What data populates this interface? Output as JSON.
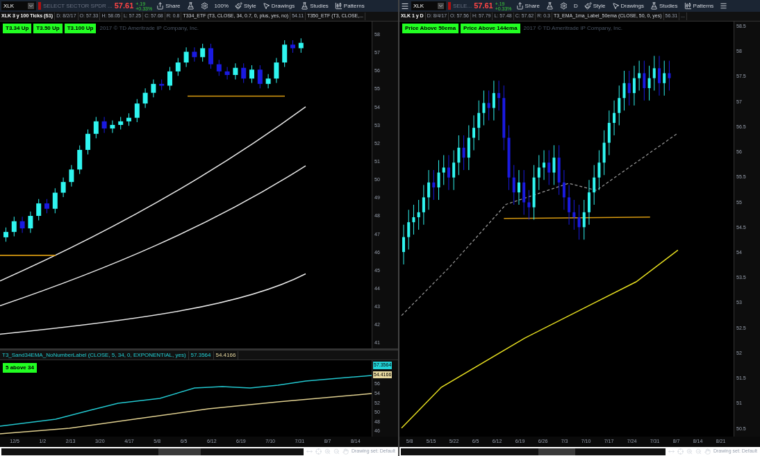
{
  "left": {
    "toolbar": {
      "symbol": "XLK",
      "description": "SELECT SECTOR SPDR ...",
      "last": "57.61",
      "change": "+.19",
      "change_pct": "+0.33%",
      "buttons": [
        {
          "kind": "share",
          "label": "Share"
        },
        {
          "kind": "flask"
        },
        {
          "kind": "gear"
        },
        {
          "kind": "text",
          "label": "100%"
        },
        {
          "kind": "style",
          "label": "Style"
        },
        {
          "kind": "pointer",
          "label": "Drawings"
        },
        {
          "kind": "flask",
          "label": "Studies"
        },
        {
          "kind": "patterns",
          "label": "Patterns"
        }
      ]
    },
    "header": [
      {
        "kind": "title",
        "text": "XLK 3 y 100 Ticks (S1)"
      },
      {
        "kind": "field",
        "text": "D: 8/2/17"
      },
      {
        "kind": "field",
        "text": "O: 57.33"
      },
      {
        "kind": "field",
        "text": "H: 58.05"
      },
      {
        "kind": "field",
        "text": "L: 57.25"
      },
      {
        "kind": "field",
        "text": "C: 57.68"
      },
      {
        "kind": "field",
        "text": "R: 0.8"
      },
      {
        "kind": "study",
        "text": "T334_ETF (T3, CLOSE, 34, 0.7, 0, plus, yes, no)"
      },
      {
        "kind": "field",
        "text": "54.11"
      },
      {
        "kind": "study",
        "text": "T350_ETF (T3, CLOSE,..."
      }
    ],
    "badges": [
      "T3.34 Up",
      "T3.50 Up",
      "T3.100 Up"
    ],
    "copyright": "2017 © TD Ameritrade IP Company, Inc.",
    "price_axis": [
      "58",
      "57",
      "56",
      "55",
      "54",
      "53",
      "52",
      "51",
      "50",
      "49",
      "48",
      "47",
      "46",
      "45",
      "44",
      "43",
      "42",
      "41"
    ],
    "study": {
      "title": "T3_Sand34EMA_NoNumberLabel (CLOSE, 5, 34, 0, EXPONENTIAL, yes)",
      "values": [
        "57.3564",
        "54.4166"
      ],
      "badge": "5 above 34",
      "axis_tags": [
        {
          "text": "57.3564",
          "color": "#22d3d8"
        },
        {
          "text": "54.4166",
          "color": "#e8d9a0"
        }
      ],
      "axis": [
        "56",
        "54",
        "52",
        "50",
        "48",
        "46"
      ]
    },
    "x_axis": [
      "12/5",
      "1/2",
      "2/13",
      "3/20",
      "4/17",
      "5/8",
      "6/5",
      "6/12",
      "6/19",
      "7/10",
      "7/31",
      "8/7",
      "8/14"
    ],
    "status": "Drawing set: Default"
  },
  "right": {
    "toolbar": {
      "symbol": "XLK",
      "description": "SELE...",
      "last": "57.61",
      "change": "+.19",
      "change_pct": "+0.33%",
      "buttons": [
        {
          "kind": "share",
          "label": "Share"
        },
        {
          "kind": "flask"
        },
        {
          "kind": "gear"
        },
        {
          "kind": "text",
          "label": "D"
        },
        {
          "kind": "style",
          "label": "Style"
        },
        {
          "kind": "pointer",
          "label": "Drawings"
        },
        {
          "kind": "flask",
          "label": "Studies"
        },
        {
          "kind": "patterns",
          "label": "Patterns"
        },
        {
          "kind": "menu"
        }
      ]
    },
    "header": [
      {
        "kind": "title",
        "text": "XLK 1 y D"
      },
      {
        "kind": "field",
        "text": "D: 8/4/17"
      },
      {
        "kind": "field",
        "text": "O: 57.56"
      },
      {
        "kind": "field",
        "text": "H: 57.79"
      },
      {
        "kind": "field",
        "text": "L: 57.48"
      },
      {
        "kind": "field",
        "text": "C: 57.62"
      },
      {
        "kind": "field",
        "text": "R: 0.3"
      },
      {
        "kind": "study",
        "text": "T3_EMA_1ma_Label_50ema (CLOSE, 50, 0, yes)"
      },
      {
        "kind": "field",
        "text": "56.31"
      },
      {
        "kind": "field",
        "text": "..."
      }
    ],
    "badges": [
      "Price Above 50ema",
      "Price Above 144ema"
    ],
    "copyright": "2017 © TD Ameritrade IP Company, Inc.",
    "price_axis": [
      "58.5",
      "58",
      "57.5",
      "57",
      "56.5",
      "56",
      "55.5",
      "55",
      "54.5",
      "54",
      "53.5",
      "53",
      "52.5",
      "52",
      "51.5",
      "51",
      "50.5"
    ],
    "x_axis": [
      "5/8",
      "5/15",
      "5/22",
      "6/5",
      "6/12",
      "6/19",
      "6/26",
      "7/3",
      "7/10",
      "7/17",
      "7/24",
      "7/31",
      "8/7",
      "8/14",
      "8/21"
    ],
    "status": "Drawing set: Default"
  }
}
